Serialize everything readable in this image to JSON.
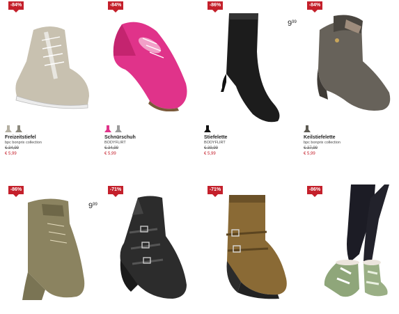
{
  "products": [
    {
      "badge": "-84%",
      "name": "Freizeitstiefel",
      "brand": "bpc bonprix collection",
      "old_price": "€ 34,99",
      "new_price": "€ 5,99",
      "colors": [
        "#b5b0a2",
        "#8d8a7e"
      ]
    },
    {
      "badge": "-84%",
      "name": "Schnürschuh",
      "brand": "BODYFLIRT",
      "old_price": "€ 34,99",
      "new_price": "€ 5,99",
      "colors": [
        "#e0338a",
        "#9c9c9c"
      ]
    },
    {
      "badge": "-86%",
      "name": "Stiefelette",
      "brand": "BODYFLIRT",
      "old_price": "€ 39,99",
      "new_price": "€ 5,99",
      "colors": [
        "#111111"
      ],
      "price_big": "9",
      "price_small": "99"
    },
    {
      "badge": "-84%",
      "name": "Keilstiefelette",
      "brand": "bpc bonprix collection",
      "old_price": "€ 37,99",
      "new_price": "€ 5,99",
      "colors": [
        "#5d5a52"
      ]
    },
    {
      "badge": "-86%",
      "price_big": "9",
      "price_small": "99"
    },
    {
      "badge": "-71%"
    },
    {
      "badge": "-71%"
    },
    {
      "badge": "-86%"
    }
  ]
}
